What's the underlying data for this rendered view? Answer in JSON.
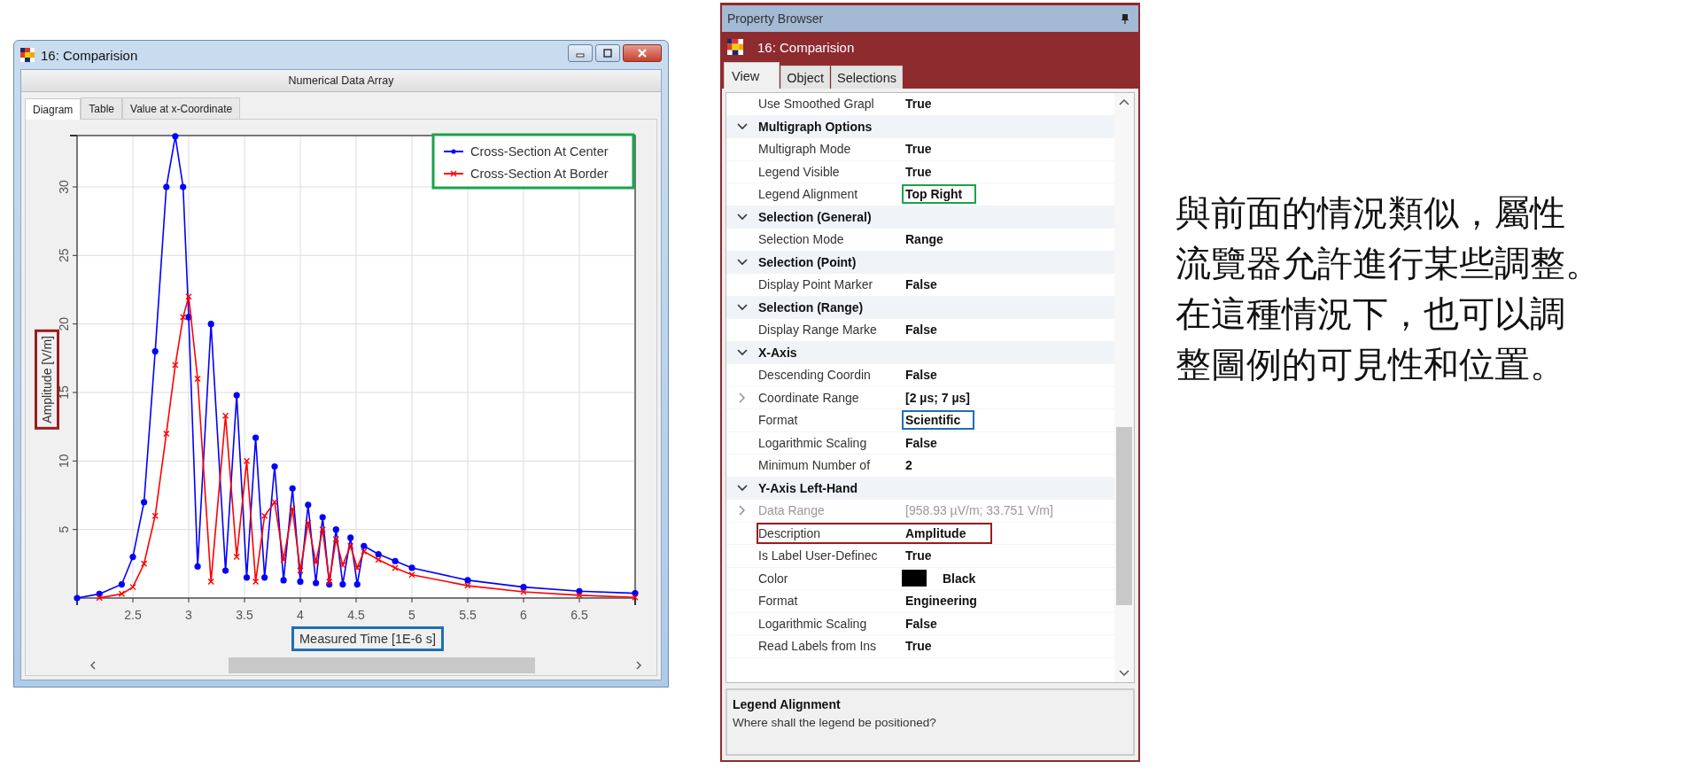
{
  "diagram_window": {
    "title": "16: Comparision",
    "header": "Numerical Data Array",
    "tabs": [
      {
        "label": "Diagram",
        "selected": true
      },
      {
        "label": "Table",
        "selected": false
      },
      {
        "label": "Value at x-Coordinate",
        "selected": false
      }
    ],
    "chart_data": {
      "type": "line",
      "xlabel": "Measured Time [1E-6 s]",
      "ylabel": "Amplitude [V/m]",
      "grid": true,
      "legend": true,
      "x": [
        2.0,
        2.2,
        2.4,
        2.5,
        2.6,
        2.7,
        2.8,
        2.88,
        2.95,
        3.0,
        3.08,
        3.2,
        3.33,
        3.43,
        3.52,
        3.6,
        3.68,
        3.77,
        3.85,
        3.93,
        4.0,
        4.07,
        4.14,
        4.2,
        4.26,
        4.32,
        4.38,
        4.45,
        4.51,
        4.57,
        4.7,
        4.85,
        5.0,
        5.5,
        6.0,
        6.5,
        7.0
      ],
      "series": [
        {
          "name": "Cross-Section At Center",
          "color": "#0000ff",
          "marker": "circle",
          "values": [
            0,
            0.3,
            1,
            3,
            7,
            18,
            30,
            33.7,
            30,
            20.5,
            2.3,
            20,
            2,
            14.8,
            1.5,
            11.7,
            1.5,
            9.6,
            1.3,
            8,
            1.2,
            6.8,
            1.1,
            5.9,
            1,
            5,
            1,
            4.4,
            1,
            3.8,
            3.2,
            2.7,
            2.2,
            1.3,
            0.8,
            0.5,
            0.35
          ]
        },
        {
          "name": "Cross-Section At Border",
          "color": "#ff0000",
          "marker": "cross",
          "values": [
            null,
            0.02,
            0.3,
            0.8,
            2.5,
            6,
            12,
            17,
            20.5,
            22,
            16,
            1.2,
            13.3,
            3,
            10,
            1.2,
            6,
            7,
            2.8,
            6.5,
            2,
            5.5,
            2.6,
            5,
            1.2,
            4.3,
            2.4,
            3.8,
            2.2,
            3.4,
            2.8,
            2.2,
            1.7,
            0.9,
            0.45,
            0.2,
            0.05
          ]
        }
      ],
      "xlim": [
        2,
        7
      ],
      "ylim": [
        0,
        33.75
      ],
      "xticks": [
        2.5,
        3,
        3.5,
        4,
        4.5,
        5,
        5.5,
        6,
        6.5
      ],
      "yticks": [
        5,
        10,
        15,
        20,
        25,
        30
      ]
    },
    "legend_frame": {
      "color": "#1aa34a"
    },
    "xlabel_frame": {
      "color": "#1f6fb5"
    },
    "ylabel_frame": {
      "color": "#9b1c1f"
    }
  },
  "property_browser": {
    "title": "Property Browser",
    "object": "16: Comparision",
    "tabs": [
      {
        "label": "View",
        "selected": true
      },
      {
        "label": "Object",
        "selected": false
      },
      {
        "label": "Selections",
        "selected": false
      }
    ],
    "rows": [
      {
        "kind": "property",
        "name": "Use Smoothed Grapl",
        "value": "True",
        "disabled": false
      },
      {
        "kind": "category",
        "name": "Multigraph Options",
        "expanded": true
      },
      {
        "kind": "property",
        "name": "Multigraph Mode",
        "value": "True",
        "disabled": false
      },
      {
        "kind": "property",
        "name": "Legend Visible",
        "value": "True",
        "disabled": false
      },
      {
        "kind": "property",
        "name": "Legend Alignment",
        "value": "Top Right",
        "disabled": false,
        "highlight": {
          "kind": "value",
          "color": "#1aa34a"
        }
      },
      {
        "kind": "category",
        "name": "Selection (General)",
        "expanded": true
      },
      {
        "kind": "property",
        "name": "Selection Mode",
        "value": "Range",
        "disabled": false
      },
      {
        "kind": "category",
        "name": "Selection (Point)",
        "expanded": true
      },
      {
        "kind": "property",
        "name": "Display Point Marker",
        "value": "False",
        "disabled": false
      },
      {
        "kind": "category",
        "name": "Selection (Range)",
        "expanded": true
      },
      {
        "kind": "property",
        "name": "Display Range Marke",
        "value": "False",
        "disabled": false
      },
      {
        "kind": "category",
        "name": "X-Axis",
        "expanded": true
      },
      {
        "kind": "property",
        "name": "Descending Coordin",
        "value": "False",
        "disabled": false
      },
      {
        "kind": "expandable",
        "name": "Coordinate Range",
        "value": "[2 µs; 7 µs]",
        "disabled": false
      },
      {
        "kind": "property",
        "name": "Format",
        "value": "Scientific",
        "disabled": false,
        "highlight": {
          "kind": "value",
          "color": "#1f6fb5"
        }
      },
      {
        "kind": "property",
        "name": "Logarithmic Scaling",
        "value": "False",
        "disabled": false
      },
      {
        "kind": "property",
        "name": "Minimum Number of",
        "value": "2",
        "disabled": false
      },
      {
        "kind": "category",
        "name": "Y-Axis Left-Hand",
        "expanded": true
      },
      {
        "kind": "expandable",
        "name": "Data Range",
        "value": "[958.93 µV/m; 33.751 V/m]",
        "disabled": true
      },
      {
        "kind": "property",
        "name": "Description",
        "value": "Amplitude",
        "disabled": false,
        "highlight": {
          "kind": "row",
          "color": "#9b1c1f"
        }
      },
      {
        "kind": "property",
        "name": "Is Label User-Definec",
        "value": "True",
        "disabled": false
      },
      {
        "kind": "color",
        "name": "Color",
        "value": "Black",
        "color": "#000000",
        "disabled": false
      },
      {
        "kind": "property",
        "name": "Format",
        "value": "Engineering",
        "disabled": false
      },
      {
        "kind": "property",
        "name": "Logarithmic Scaling",
        "value": "False",
        "disabled": false
      },
      {
        "kind": "property",
        "name": "Read Labels from Ins",
        "value": "True",
        "disabled": false
      }
    ],
    "help": {
      "title": "Legend Alignment",
      "text": "Where shall the legend be positioned?"
    }
  },
  "note": [
    "與前面的情況類似，屬性",
    "流覽器允許進行某些調整。",
    "在這種情況下，也可以調",
    "整圖例的可見性和位置。"
  ]
}
